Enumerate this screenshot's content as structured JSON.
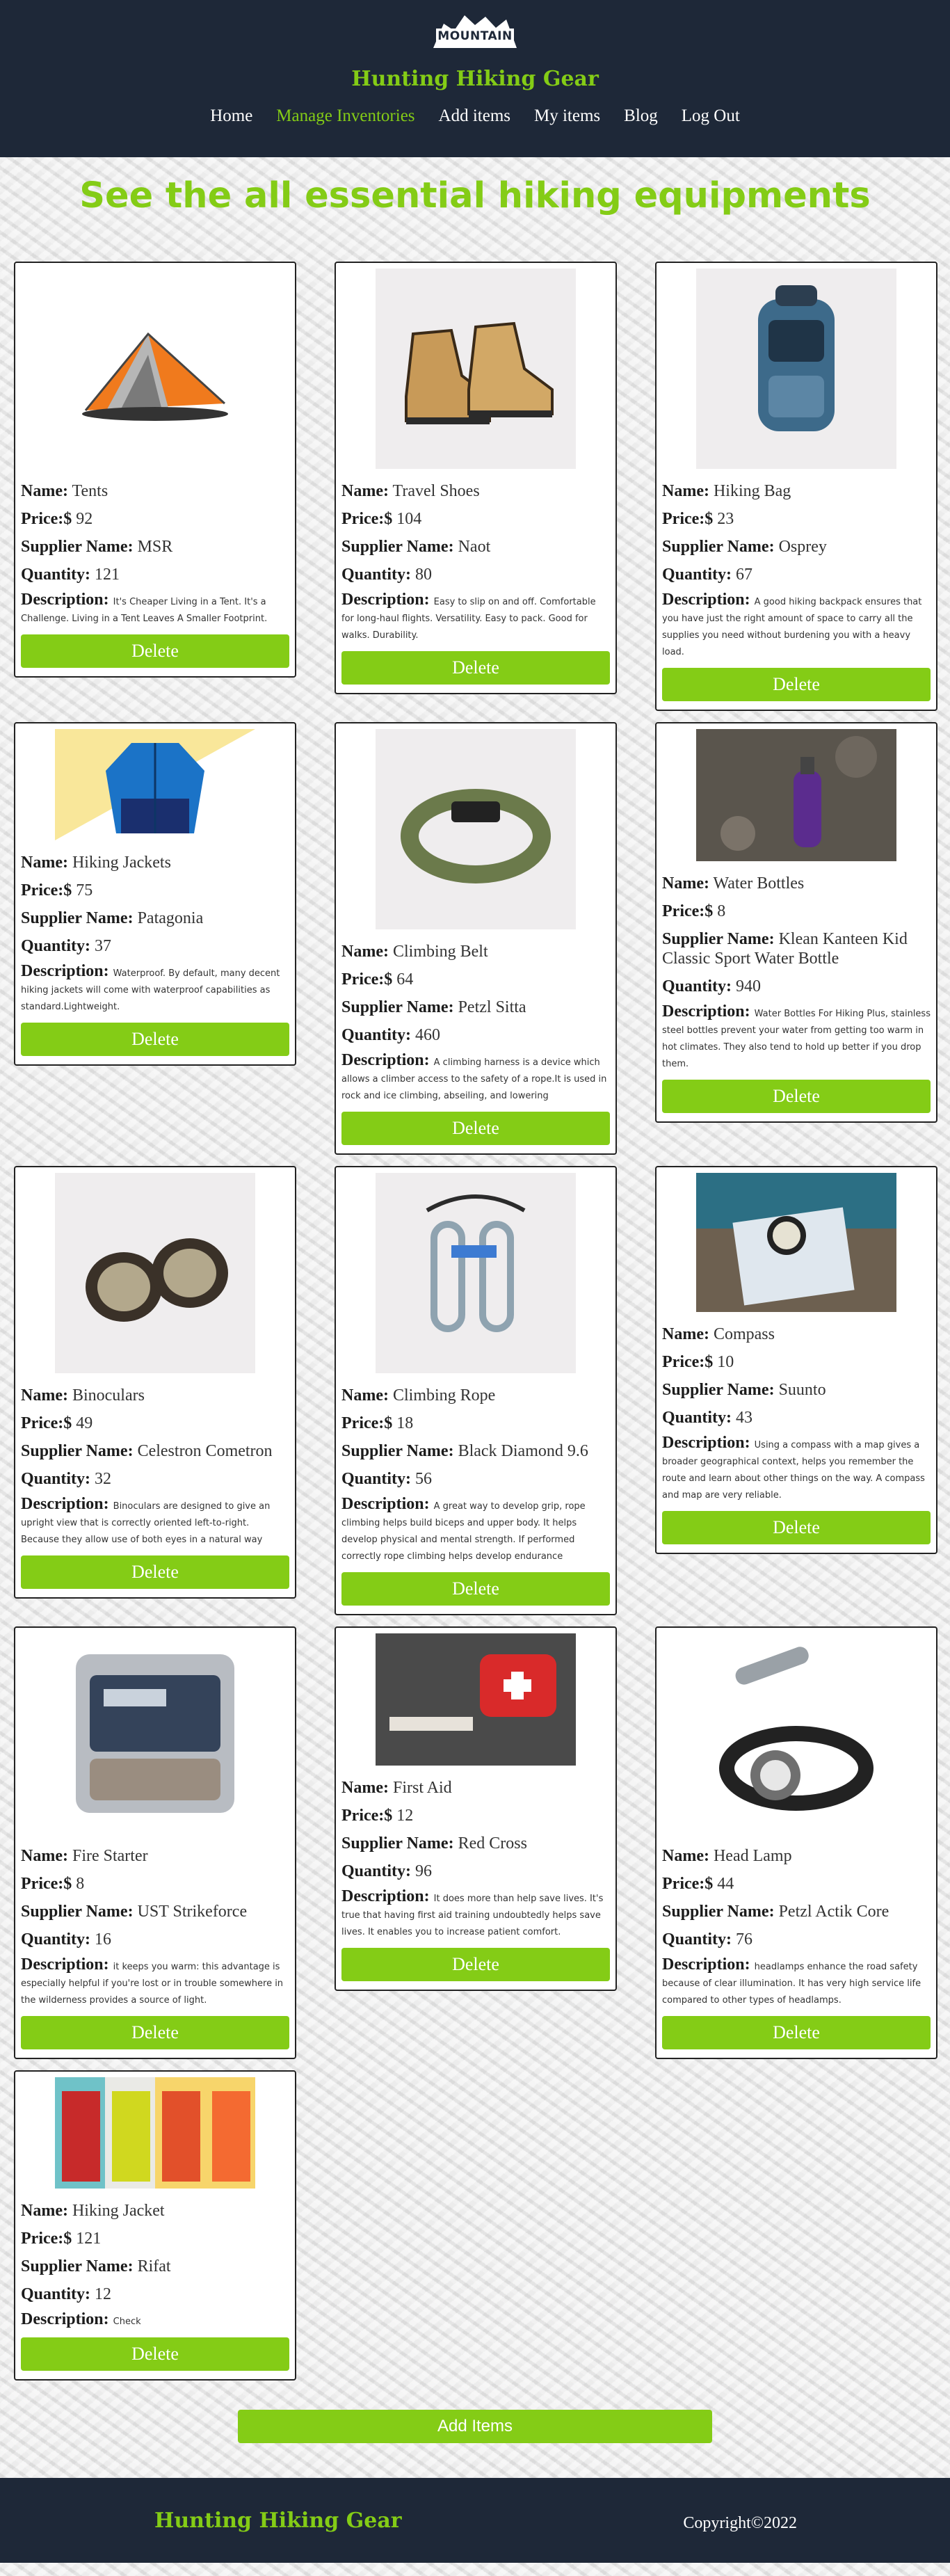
{
  "header": {
    "logo_text": "MOUNTAIN",
    "brand": "Hunting Hiking Gear",
    "nav": [
      "Home",
      "Manage Inventories",
      "Add items",
      "My items",
      "Blog",
      "Log Out"
    ]
  },
  "main": {
    "heading": "See the all essential hiking equipments",
    "labels": {
      "name": "Name:",
      "price": "Price:$",
      "supplier": "Supplier Name:",
      "quantity": "Quantity:",
      "description": "Description:",
      "delete": "Delete"
    },
    "items": [
      {
        "name": "Tents",
        "price": "92",
        "supplier": "MSR",
        "quantity": "121",
        "description": "It's Cheaper Living in a Tent. It's a Challenge. Living in a Tent Leaves A Smaller Footprint.",
        "image": "tent-image"
      },
      {
        "name": "Travel Shoes",
        "price": "104",
        "supplier": "Naot",
        "quantity": "80",
        "description": "Easy to slip on and off. Comfortable for long-haul flights. Versatility. Easy to pack. Good for walks. Durability.",
        "image": "shoes-image"
      },
      {
        "name": "Hiking Bag",
        "price": "23",
        "supplier": "Osprey",
        "quantity": "67",
        "description": "A good hiking backpack ensures that you have just the right amount of space to carry all the supplies you need without burdening you with a heavy load.",
        "image": "backpack-image"
      },
      {
        "name": "Hiking Jackets",
        "price": "75",
        "supplier": "Patagonia",
        "quantity": "37",
        "description": "Waterproof. By default, many decent hiking jackets will come with waterproof capabilities as standard.Lightweight.",
        "image": "jacket-image"
      },
      {
        "name": "Climbing Belt",
        "price": "64",
        "supplier": "Petzl Sitta",
        "quantity": "460",
        "description": "A climbing harness is a device which allows a climber access to the safety of a rope.It is used in rock and ice climbing, abseiling, and lowering",
        "image": "belt-image"
      },
      {
        "name": "Water Bottles",
        "price": "8",
        "supplier": "Klean Kanteen Kid Classic Sport Water Bottle",
        "quantity": "940",
        "description": "Water Bottles For Hiking Plus, stainless steel bottles prevent your water from getting too warm in hot climates. They also tend to hold up better if you drop them.",
        "image": "bottle-image"
      },
      {
        "name": "Binoculars",
        "price": "49",
        "supplier": "Celestron Cometron",
        "quantity": "32",
        "description": "Binoculars are designed to give an upright view that is correctly oriented left-to-right. Because they allow use of both eyes in a natural way",
        "image": "binoculars-image"
      },
      {
        "name": "Climbing Rope",
        "price": "18",
        "supplier": "Black Diamond 9.6",
        "quantity": "56",
        "description": "A great way to develop grip, rope climbing helps build biceps and upper body. It helps develop physical and mental strength. If performed correctly rope climbing helps develop endurance",
        "image": "rope-image"
      },
      {
        "name": "Compass",
        "price": "10",
        "supplier": "Suunto",
        "quantity": "43",
        "description": "Using a compass with a map gives a broader geographical context, helps you remember the route and learn about other things on the way. A compass and map are very reliable.",
        "image": "compass-image"
      },
      {
        "name": "Fire Starter",
        "price": "8",
        "supplier": "UST Strikeforce",
        "quantity": "16",
        "description": "it keeps you warm: this advantage is especially helpful if you're lost or in trouble somewhere in the wilderness provides a source of light.",
        "image": "firestarter-image"
      },
      {
        "name": "First Aid",
        "price": "12",
        "supplier": "Red Cross",
        "quantity": "96",
        "description": "It does more than help save lives. It's true that having first aid training undoubtedly helps save lives. It enables you to increase patient comfort.",
        "image": "firstaid-image"
      },
      {
        "name": "Head Lamp",
        "price": "44",
        "supplier": "Petzl Actik Core",
        "quantity": "76",
        "description": "headlamps enhance the road safety because of clear illumination. It has very high service life compared to other types of headlamps.",
        "image": "headlamp-image"
      },
      {
        "name": "Hiking Jacket",
        "price": "121",
        "supplier": "Rifat",
        "quantity": "12",
        "description": "Check",
        "image": "jackets-image"
      }
    ],
    "add_button": "Add Items"
  },
  "footer": {
    "brand": "Hunting Hiking Gear",
    "copyright": "Copyright©2022"
  },
  "colors": {
    "accent": "#84cc16",
    "header_bg": "#1e2838"
  }
}
